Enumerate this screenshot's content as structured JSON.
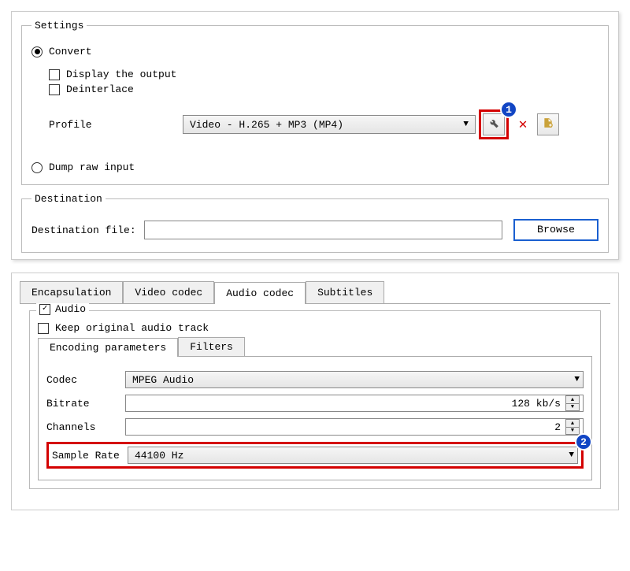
{
  "settings": {
    "legend": "Settings",
    "convert": {
      "label": "Convert",
      "checked": true
    },
    "display_output": {
      "label": "Display the output",
      "checked": false
    },
    "deinterlace": {
      "label": "Deinterlace",
      "checked": false
    },
    "profile_label": "Profile",
    "profile_value": "Video - H.265 + MP3 (MP4)",
    "dump_raw": {
      "label": "Dump raw input",
      "checked": false
    }
  },
  "destination": {
    "legend": "Destination",
    "file_label": "Destination file:",
    "file_value": "",
    "browse": "Browse"
  },
  "tabs": {
    "encapsulation": "Encapsulation",
    "video_codec": "Video codec",
    "audio_codec": "Audio codec",
    "subtitles": "Subtitles"
  },
  "audio": {
    "group_label": "Audio",
    "group_checked": true,
    "keep_original": {
      "label": "Keep original audio track",
      "checked": false
    },
    "subtabs": {
      "encoding": "Encoding parameters",
      "filters": "Filters"
    },
    "fields": {
      "codec": {
        "label": "Codec",
        "value": "MPEG Audio"
      },
      "bitrate": {
        "label": "Bitrate",
        "value": "128 kb/s"
      },
      "channels": {
        "label": "Channels",
        "value": "2"
      },
      "sample_rate": {
        "label": "Sample Rate",
        "value": "44100 Hz"
      }
    }
  },
  "callouts": {
    "one": "1",
    "two": "2"
  }
}
